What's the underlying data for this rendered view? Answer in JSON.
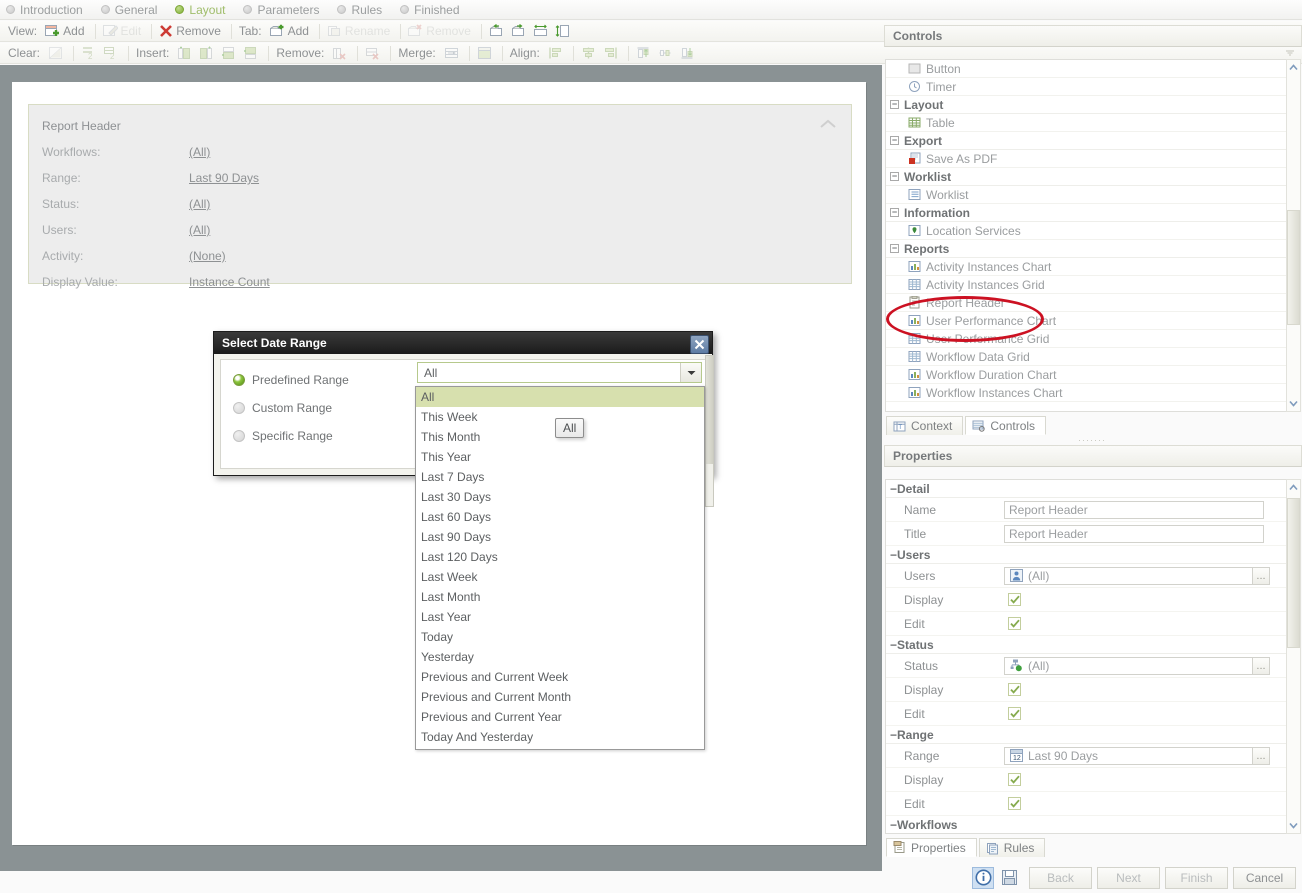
{
  "wizard": {
    "steps": [
      {
        "label": "Introduction",
        "active": false
      },
      {
        "label": "General",
        "active": false
      },
      {
        "label": "Layout",
        "active": true
      },
      {
        "label": "Parameters",
        "active": false
      },
      {
        "label": "Rules",
        "active": false
      },
      {
        "label": "Finished",
        "active": false
      }
    ]
  },
  "toolbar_view": {
    "view_label": "View:",
    "add_label": "Add",
    "edit_label": "Edit",
    "remove_label": "Remove",
    "tab_label": "Tab:",
    "tab_add_label": "Add",
    "tab_rename_label": "Rename",
    "tab_remove_label": "Remove"
  },
  "toolbar_edit": {
    "clear_label": "Clear:",
    "insert_label": "Insert:",
    "remove_label": "Remove:",
    "merge_label": "Merge:",
    "align_label": "Align:"
  },
  "report_header": {
    "title": "Report Header",
    "rows": [
      {
        "label": "Workflows:",
        "value": "(All)"
      },
      {
        "label": "Range:",
        "value": "Last 90 Days"
      },
      {
        "label": "Status:",
        "value": "(All)"
      },
      {
        "label": "Users:",
        "value": "(All)"
      },
      {
        "label": "Activity:",
        "value": "(None)"
      },
      {
        "label": "Display Value:",
        "value": "Instance Count"
      }
    ]
  },
  "dialog": {
    "title": "Select Date Range",
    "close_label": "✕",
    "options": [
      {
        "label": "Predefined Range",
        "selected": true
      },
      {
        "label": "Custom Range",
        "selected": false
      },
      {
        "label": "Specific Range",
        "selected": false
      }
    ],
    "combo_value": "All",
    "tooltip": "All",
    "dropdown_items": [
      "All",
      "This Week",
      "This Month",
      "This Year",
      "Last 7 Days",
      "Last 30 Days",
      "Last 60 Days",
      "Last 90 Days",
      "Last 120 Days",
      "Last Week",
      "Last Month",
      "Last Year",
      "Today",
      "Yesterday",
      "Previous and Current Week",
      "Previous and Current Month",
      "Previous and Current Year",
      "Today And Yesterday"
    ],
    "dropdown_selected": "All"
  },
  "controls_panel": {
    "title": "Controls",
    "entries": [
      {
        "kind": "item",
        "label": "Button",
        "icon": "button-icon"
      },
      {
        "kind": "item",
        "label": "Timer",
        "icon": "timer-icon"
      },
      {
        "kind": "group",
        "label": "Layout"
      },
      {
        "kind": "item",
        "label": "Table",
        "icon": "table-icon"
      },
      {
        "kind": "group",
        "label": "Export"
      },
      {
        "kind": "item",
        "label": "Save As PDF",
        "icon": "pdf-icon"
      },
      {
        "kind": "group",
        "label": "Worklist"
      },
      {
        "kind": "item",
        "label": "Worklist",
        "icon": "worklist-icon"
      },
      {
        "kind": "group",
        "label": "Information"
      },
      {
        "kind": "item",
        "label": "Location Services",
        "icon": "location-icon"
      },
      {
        "kind": "group",
        "label": "Reports"
      },
      {
        "kind": "item",
        "label": "Activity Instances Chart",
        "icon": "chart-icon"
      },
      {
        "kind": "item",
        "label": "Activity Instances Grid",
        "icon": "grid-icon"
      },
      {
        "kind": "item",
        "label": "Report Header",
        "icon": "report-header-icon",
        "highlighted": true
      },
      {
        "kind": "item",
        "label": "User Performance Chart",
        "icon": "chart-icon"
      },
      {
        "kind": "item",
        "label": "User Performance Grid",
        "icon": "grid-icon"
      },
      {
        "kind": "item",
        "label": "Workflow Data Grid",
        "icon": "grid-icon"
      },
      {
        "kind": "item",
        "label": "Workflow Duration Chart",
        "icon": "chart-icon"
      },
      {
        "kind": "item",
        "label": "Workflow Instances Chart",
        "icon": "chart-icon"
      }
    ],
    "tabs": [
      {
        "label": "Context",
        "icon": "context-icon",
        "active": false
      },
      {
        "label": "Controls",
        "icon": "controls-icon",
        "active": true
      }
    ]
  },
  "properties_panel": {
    "title": "Properties",
    "rows": [
      {
        "kind": "group",
        "label": "Detail"
      },
      {
        "kind": "text",
        "label": "Name",
        "value": "Report Header"
      },
      {
        "kind": "text",
        "label": "Title",
        "value": "Report Header"
      },
      {
        "kind": "group",
        "label": "Users"
      },
      {
        "kind": "picker",
        "label": "Users",
        "value": "(All)",
        "icon": "user-icon",
        "ellipsis": "..."
      },
      {
        "kind": "check",
        "label": "Display",
        "checked": true
      },
      {
        "kind": "check",
        "label": "Edit",
        "checked": true
      },
      {
        "kind": "group",
        "label": "Status"
      },
      {
        "kind": "picker",
        "label": "Status",
        "value": "(All)",
        "icon": "status-icon",
        "ellipsis": "..."
      },
      {
        "kind": "check",
        "label": "Display",
        "checked": true
      },
      {
        "kind": "check",
        "label": "Edit",
        "checked": true
      },
      {
        "kind": "group",
        "label": "Range"
      },
      {
        "kind": "picker",
        "label": "Range",
        "value": "Last 90 Days",
        "icon": "calendar-icon",
        "ellipsis": "..."
      },
      {
        "kind": "check",
        "label": "Display",
        "checked": true
      },
      {
        "kind": "check",
        "label": "Edit",
        "checked": true
      },
      {
        "kind": "group",
        "label": "Workflows"
      }
    ],
    "tabs": [
      {
        "label": "Properties",
        "icon": "properties-icon",
        "active": true
      },
      {
        "label": "Rules",
        "icon": "rules-icon",
        "active": false
      }
    ]
  },
  "footer": {
    "info_label": "i",
    "save_label": "save-icon",
    "buttons": [
      {
        "label": "Back",
        "disabled": true
      },
      {
        "label": "Next",
        "disabled": true
      },
      {
        "label": "Finish",
        "disabled": true
      },
      {
        "label": "Cancel",
        "disabled": false
      }
    ]
  },
  "colors": {
    "accent_green": "#8ec63f",
    "canvas_gray": "#8a9294",
    "highlight_red": "#cc1122",
    "selection_green": "#d7e0ae"
  }
}
